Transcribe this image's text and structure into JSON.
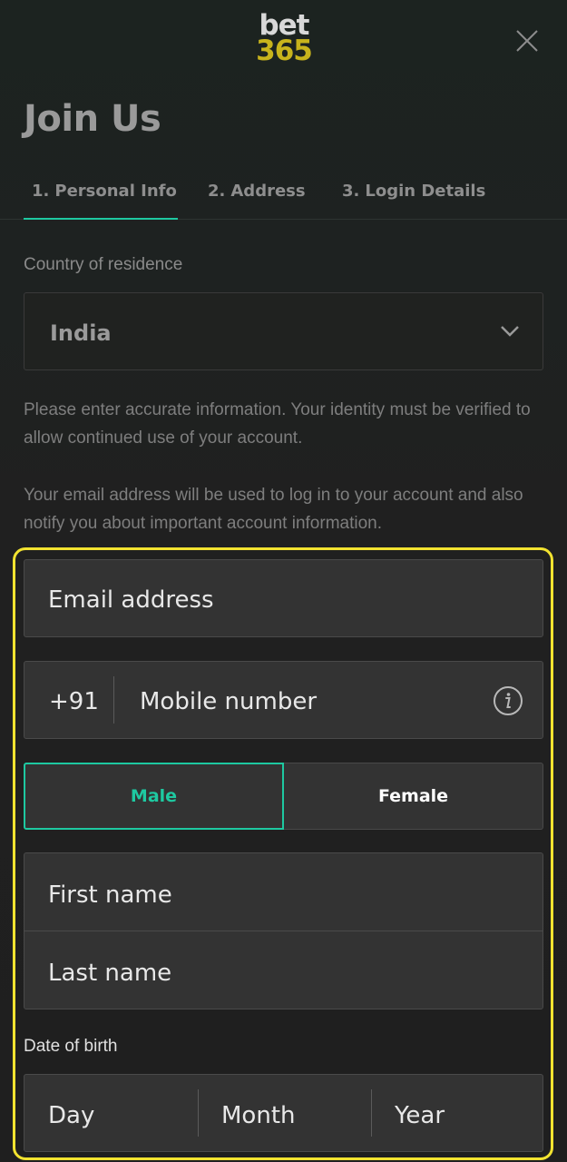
{
  "header": {
    "logo_line1": "bet",
    "logo_line2": "365"
  },
  "page_title": "Join Us",
  "tabs": [
    {
      "num": "1.",
      "label": "Personal Info",
      "active": true
    },
    {
      "num": "2.",
      "label": "Address",
      "active": false
    },
    {
      "num": "3.",
      "label": "Login Details",
      "active": false
    }
  ],
  "country": {
    "label": "Country of residence",
    "value": "India"
  },
  "info_text_1": "Please enter accurate information. Your identity must be verified to allow continued use of your account.",
  "info_text_2": "Your email address will be used to log in to your account and also notify you about important account information.",
  "form": {
    "email_placeholder": "Email address",
    "mobile_code": "+91",
    "mobile_placeholder": "Mobile number",
    "gender_male": "Male",
    "gender_female": "Female",
    "gender_selected": "Male",
    "first_name_placeholder": "First name",
    "last_name_placeholder": "Last name",
    "dob_label": "Date of birth",
    "dob_day": "Day",
    "dob_month": "Month",
    "dob_year": "Year"
  },
  "colors": {
    "accent": "#1ec9a1",
    "highlight": "#f2e330",
    "logo_yellow": "#c8b41c"
  },
  "icons": {
    "close": "close-icon",
    "chevron": "chevron-down-icon",
    "info": "info-icon"
  }
}
